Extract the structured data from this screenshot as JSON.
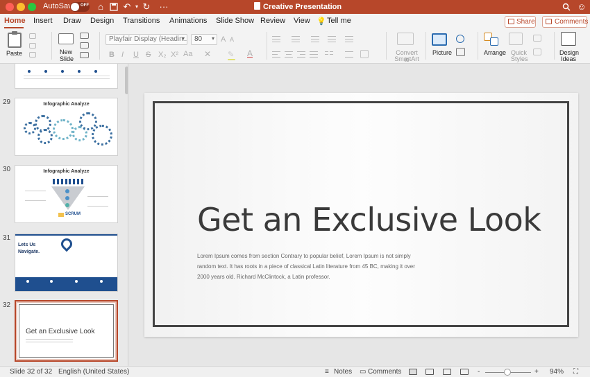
{
  "app": {
    "autosave_label": "AutoSave",
    "autosave_state": "OFF",
    "document_title": "Creative Presentation",
    "accent_color": "#b7472a"
  },
  "tabs": [
    "Home",
    "Insert",
    "Draw",
    "Design",
    "Transitions",
    "Animations",
    "Slide Show",
    "Review",
    "View"
  ],
  "tell_me": "Tell me",
  "share_label": "Share",
  "comments_label": "Comments",
  "ribbon": {
    "paste": "Paste",
    "new_slide_line1": "New",
    "new_slide_line2": "Slide",
    "font_name": "Playfair Display (Headin...",
    "font_size": "80",
    "convert_line1": "Convert to",
    "convert_line2": "SmartArt",
    "picture": "Picture",
    "arrange": "Arrange",
    "quick_line1": "Quick",
    "quick_line2": "Styles",
    "design_line1": "Design",
    "design_line2": "Ideas",
    "format_bold": "B",
    "format_italic": "I",
    "format_underline": "U",
    "format_strike": "S",
    "format_sub": "X₂",
    "format_sup": "X²",
    "font_grow": "A",
    "font_shrink": "A",
    "font_case": "Aa",
    "font_color": "A"
  },
  "thumbnails": {
    "slide29": {
      "number": "29",
      "title": "Infographic Analyze"
    },
    "slide30": {
      "number": "30",
      "title": "Infographic Analyze",
      "footer": "SCRUM"
    },
    "slide31": {
      "number": "31",
      "title_line1": "Lets Us",
      "title_line2": "Navigate."
    },
    "slide32": {
      "number": "32",
      "title": "Get an Exclusive Look"
    }
  },
  "slide": {
    "title": "Get an Exclusive Look",
    "body": "Lorem Ipsum comes from section Contrary to popular belief, Lorem Ipsum is not simply random text. It has roots in a piece of classical Latin literature from 45 BC, making it over 2000 years old. Richard McClintock, a Latin professor."
  },
  "status": {
    "slide_counter": "Slide 32 of 32",
    "language": "English (United States)",
    "notes": "Notes",
    "comments": "Comments",
    "zoom_minus": "-",
    "zoom_plus": "+",
    "zoom": "94%"
  }
}
